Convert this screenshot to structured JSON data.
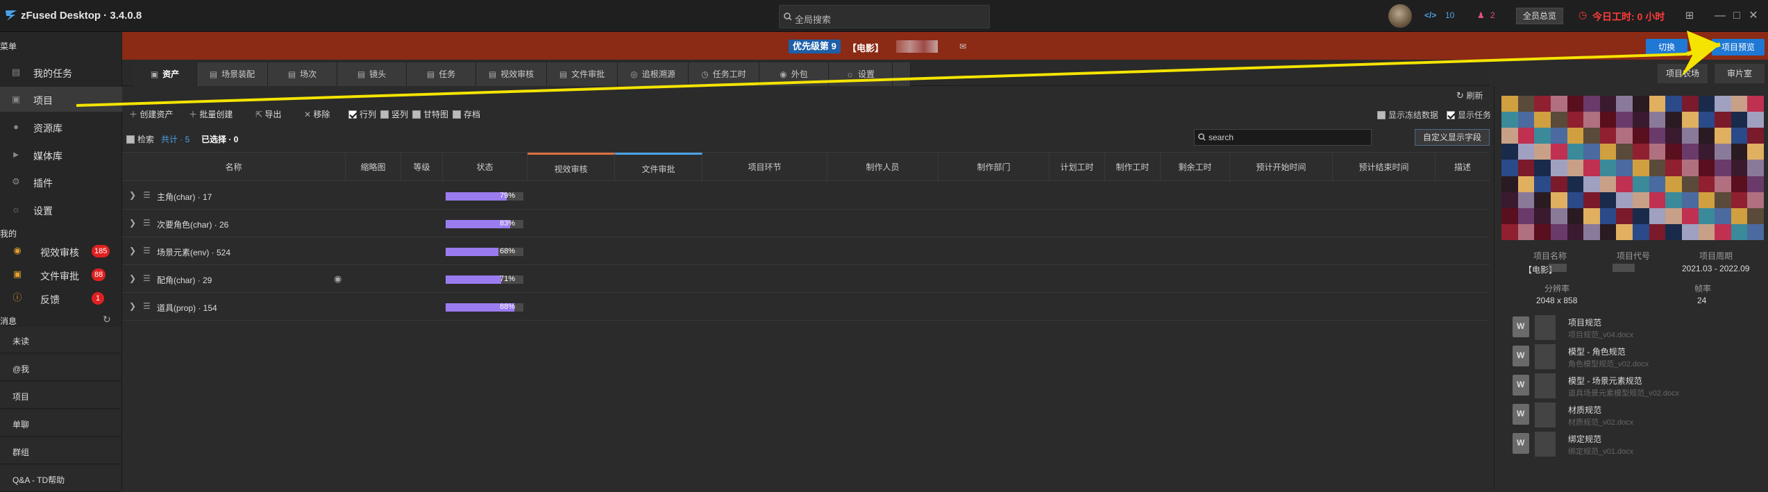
{
  "app": {
    "title": "zFused Desktop · 3.4.0.8"
  },
  "topbar": {
    "search_placeholder": "全局搜索",
    "code_badge": "10",
    "user_badge": "2",
    "summary_button": "全员总览",
    "worktime": "今日工时: 0 小时"
  },
  "sidebar": {
    "menu_header": "菜单",
    "items": [
      {
        "label": "我的任务",
        "icon": "task-icon"
      },
      {
        "label": "项目",
        "icon": "folder-icon"
      },
      {
        "label": "资源库",
        "icon": "globe-icon"
      },
      {
        "label": "媒体库",
        "icon": "media-icon"
      },
      {
        "label": "插件",
        "icon": "plugin-icon"
      },
      {
        "label": "设置",
        "icon": "gear-icon"
      }
    ],
    "my_header": "我的",
    "my_items": [
      {
        "label": "视效审核",
        "count": "185"
      },
      {
        "label": "文件审批",
        "count": "88"
      },
      {
        "label": "反馈",
        "count": "1"
      }
    ],
    "msg_header": "消息",
    "msg_items": [
      "未读",
      "@我",
      "项目",
      "单聊",
      "群组",
      "Q&A - TD帮助"
    ]
  },
  "project": {
    "priority": "优先级第 9",
    "name": "【电影】",
    "buttons": [
      "切换",
      "项目预览"
    ]
  },
  "tabs": [
    "资产",
    "场景装配",
    "场次",
    "镜头",
    "任务",
    "视效审核",
    "文件审批",
    "追根溯源",
    "任务工时",
    "外包",
    "设置"
  ],
  "right_tabs": [
    "项目农场",
    "审片室"
  ],
  "toolbar": {
    "create": "创建资产",
    "batch": "批量创建",
    "export": "导出",
    "remove": "移除",
    "row": "行列",
    "col": "竖列",
    "gantt": "甘特图",
    "archive": "存档",
    "refresh": "刷新",
    "show_frozen": "显示冻结数据",
    "show_task": "显示任务"
  },
  "count": {
    "search_label": "检索",
    "total": "共计 · 5",
    "selected": "已选择 · 0"
  },
  "search": {
    "placeholder": "search"
  },
  "custom_button": "自定义显示字段",
  "columns": [
    "名称",
    "缩略图",
    "等级",
    "状态",
    "视效审核",
    "文件审批",
    "项目环节",
    "制作人员",
    "制作部门",
    "计划工时",
    "制作工时",
    "剩余工时",
    "预计开始时间",
    "预计结束时间",
    "描述"
  ],
  "rows": [
    {
      "name": "主角(char) · 17",
      "progress": 79,
      "pct": "79%"
    },
    {
      "name": "次要角色(char) · 26",
      "progress": 83,
      "pct": "83%"
    },
    {
      "name": "场景元素(env) · 524",
      "progress": 68,
      "pct": "68%"
    },
    {
      "name": "配角(char) · 29",
      "progress": 71,
      "pct": "71%"
    },
    {
      "name": "道具(prop) · 154",
      "progress": 88,
      "pct": "88%"
    }
  ],
  "panel": {
    "labels": [
      "项目名称",
      "项目代号",
      "项目周期",
      "分辨率",
      "帧率"
    ],
    "values": {
      "name": "【电影】",
      "period": "2021.03 - 2022.09",
      "resolution": "2048 x 858",
      "fps": "24"
    },
    "docs": [
      {
        "name": "项目规范",
        "file": "项目规范_v04.docx"
      },
      {
        "name": "模型 - 角色规范",
        "file": "角色模型规范_v02.docx"
      },
      {
        "name": "模型 - 场景元素规范",
        "file": "道具场景元素模型规范_v02.docx"
      },
      {
        "name": "材质规范",
        "file": "材质规范_v02.docx"
      },
      {
        "name": "绑定规范",
        "file": "绑定规范_v01.docx"
      }
    ]
  },
  "colors": {
    "accent": "#1e78d4",
    "project_bar": "#8b2a15",
    "progress": "#9a7cf0",
    "alert": "#ff3b3b",
    "arrow": "#f5e400"
  }
}
